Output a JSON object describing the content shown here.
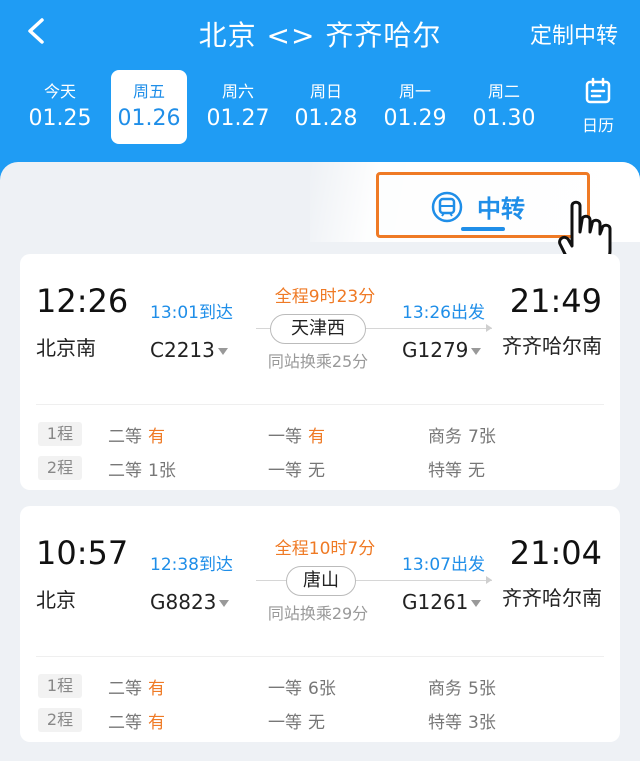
{
  "header": {
    "title": "北京 <> 齐齐哈尔",
    "custom_transfer": "定制中转",
    "calendar_label": "日历"
  },
  "dates": [
    {
      "day": "今天",
      "date": "01.25",
      "selected": false
    },
    {
      "day": "周五",
      "date": "01.26",
      "selected": true
    },
    {
      "day": "周六",
      "date": "01.27",
      "selected": false
    },
    {
      "day": "周日",
      "date": "01.28",
      "selected": false
    },
    {
      "day": "周一",
      "date": "01.29",
      "selected": false
    },
    {
      "day": "周二",
      "date": "01.30",
      "selected": false
    }
  ],
  "tab": {
    "label": "中转"
  },
  "trips": [
    {
      "depart_time": "12:26",
      "depart_station": "北京南",
      "leg1_arrive": "13:01到达",
      "leg1_train": "C2213",
      "total": "全程9时23分",
      "hub": "天津西",
      "wait": "同站换乘25分",
      "leg2_depart": "13:26出发",
      "leg2_train": "G1279",
      "arrive_time": "21:49",
      "arrive_station": "齐齐哈尔南",
      "legs": [
        {
          "label": "1程",
          "seats": [
            {
              "name": "二等",
              "value": "有",
              "avail": true
            },
            {
              "name": "一等",
              "value": "有",
              "avail": true
            },
            {
              "name": "商务",
              "value": "7张",
              "avail": false
            }
          ]
        },
        {
          "label": "2程",
          "seats": [
            {
              "name": "二等",
              "value": "1张",
              "avail": false
            },
            {
              "name": "一等",
              "value": "无",
              "avail": false
            },
            {
              "name": "特等",
              "value": "无",
              "avail": false
            }
          ]
        }
      ]
    },
    {
      "depart_time": "10:57",
      "depart_station": "北京",
      "leg1_arrive": "12:38到达",
      "leg1_train": "G8823",
      "total": "全程10时7分",
      "hub": "唐山",
      "wait": "同站换乘29分",
      "leg2_depart": "13:07出发",
      "leg2_train": "G1261",
      "arrive_time": "21:04",
      "arrive_station": "齐齐哈尔南",
      "legs": [
        {
          "label": "1程",
          "seats": [
            {
              "name": "二等",
              "value": "有",
              "avail": true
            },
            {
              "name": "一等",
              "value": "6张",
              "avail": false
            },
            {
              "name": "商务",
              "value": "5张",
              "avail": false
            }
          ]
        },
        {
          "label": "2程",
          "seats": [
            {
              "name": "二等",
              "value": "有",
              "avail": true
            },
            {
              "name": "一等",
              "value": "无",
              "avail": false
            },
            {
              "name": "特等",
              "value": "3张",
              "avail": false
            }
          ]
        }
      ]
    }
  ],
  "icons": {
    "back": "chevron-left-icon",
    "calendar": "calendar-icon",
    "tab": "train-icon",
    "pointer": "hand-pointer-icon"
  },
  "colors": {
    "header": "#1f9cf4",
    "accent_blue": "#1f8ee8",
    "accent_orange": "#ef7a25"
  }
}
